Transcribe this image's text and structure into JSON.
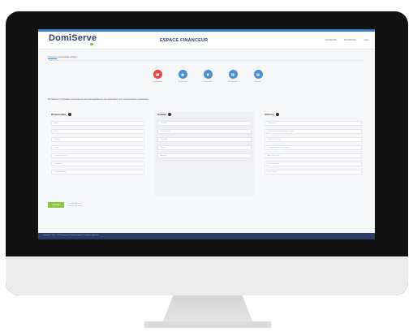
{
  "header": {
    "logo": "DomiServe",
    "title": "ESPACE FINANCEUR",
    "nav": [
      "CONNEXION",
      "INSCRIPTION",
      "AIDE"
    ]
  },
  "breadcrumb": {
    "link": "Connexion",
    "current": "Commander en ligne"
  },
  "steps": [
    {
      "label": "Coordonnées",
      "icon": "id-card-icon",
      "active": true
    },
    {
      "label": "Bénéficiaire",
      "icon": "users-icon",
      "active": false
    },
    {
      "label": "Commande",
      "icon": "cart-icon",
      "active": false
    },
    {
      "label": "Récapitulatif",
      "icon": "list-icon",
      "active": false
    },
    {
      "label": "Paiement",
      "icon": "card-icon",
      "active": false
    }
  ],
  "intro": "Remplissez le formulaire ci-dessous et nous sauvegarderons vos informations pour vos prochaines commandes.",
  "panels": {
    "responsable": {
      "title": "Responsable",
      "fields": [
        "Civilité*",
        "Nom*",
        "Prénom*",
        "E-mail*",
        "Confirmation e-mail*",
        "Téléphone*",
        "Téléphone mobile"
      ]
    },
    "societe": {
      "title": "Société",
      "fields": [
        "N° SIRET",
        "Raison sociale*",
        "Code NAF",
        "Effectif*",
        "Agrément*"
      ]
    },
    "adresse": {
      "title": "Adresse",
      "fields": [
        "Destinataire",
        "Complément destinataire (Appt, escalier)",
        "Numéro, voie et rue",
        "Complément adresse (BP, lieu-dit)",
        "Code Postal / Ville*",
        "Téléphone société",
        "E-mail société"
      ]
    }
  },
  "validate_label": "VALIDER",
  "legend": [
    "* Champs obligatoires",
    "Pas de frais de dossier"
  ],
  "footer": "Copyright © 2017 - 2022 Domiserve | Mentions légales | Conditions générales"
}
